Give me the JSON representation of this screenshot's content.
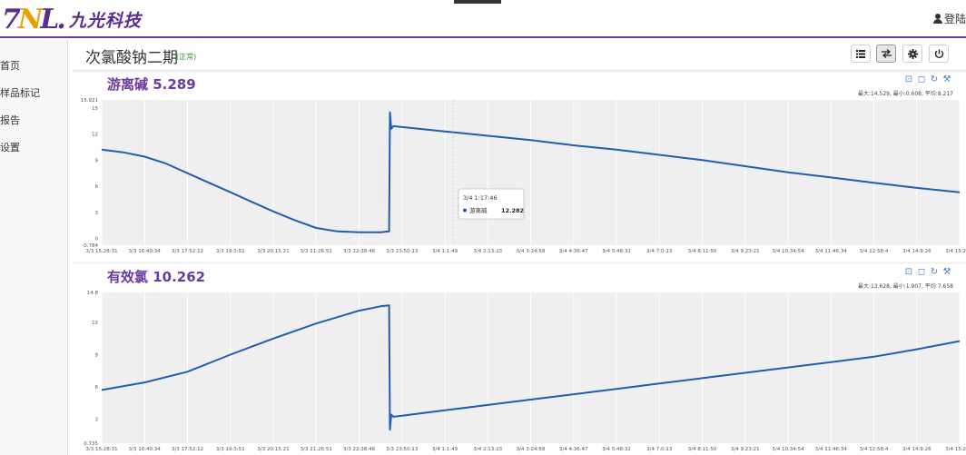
{
  "header": {
    "logo_mark": "7",
    "logo_mark_dot": "N",
    "logo_mark_end": "L.",
    "logo_text": "九光科技",
    "login_label": "登陆"
  },
  "sidebar": {
    "items": [
      {
        "label": "首页"
      },
      {
        "label": "样品标记"
      },
      {
        "label": "报告"
      },
      {
        "label": "设置"
      }
    ]
  },
  "page": {
    "title": "次氯酸钠二期",
    "status": "(正常)",
    "toolbar": {
      "list_icon": "list-icon",
      "swap_icon": "swap-icon",
      "gear_icon": "gear-icon",
      "power_icon": "power-icon"
    }
  },
  "colors": {
    "accent": "#6b3aa0",
    "series": "#1f5fb0",
    "plot_bg": "#efefef",
    "status_ok": "#2e9a2e"
  },
  "chart_data": [
    {
      "type": "line",
      "title": "游离碱 5.289",
      "stats": "最大:14.529, 最小:0.608, 平均:8.217",
      "y_tick_labels": [
        "15.921",
        "15",
        "12",
        "9",
        "6",
        "3",
        "0",
        "-0.784"
      ],
      "ylim": [
        -0.784,
        15.921
      ],
      "x_tick_labels": [
        "3/3 15:28:31",
        "3/3 16:40:34",
        "3/3 17:52:12",
        "3/3 19:3:51",
        "3/3 20:15:21",
        "3/3 21:26:51",
        "3/3 22:38:46",
        "3/3 23:50:13",
        "3/4 1:1:49",
        "3/4 2:13:23",
        "3/4 3:24:58",
        "3/4 4:36:47",
        "3/4 5:48:32",
        "3/4 7:0:13",
        "3/4 8:11:50",
        "3/4 9:23:21",
        "3/4 10:34:54",
        "3/4 11:46:34",
        "3/4 12:58:4",
        "3/4 14:9:26",
        "3/4 15:20:5"
      ],
      "x": [
        0,
        0.5,
        1,
        1.5,
        2,
        2.5,
        3,
        3.5,
        4,
        4.5,
        5,
        5.5,
        6,
        6.5,
        6.7,
        6.72,
        6.75,
        6.8,
        7,
        8,
        9,
        10,
        11,
        12,
        13,
        14,
        15,
        16,
        17,
        18,
        19,
        20
      ],
      "values": [
        10.2,
        9.9,
        9.4,
        8.6,
        7.5,
        6.4,
        5.3,
        4.2,
        3.1,
        2.1,
        1.2,
        0.8,
        0.7,
        0.7,
        0.8,
        14.5,
        12.6,
        12.9,
        12.8,
        12.3,
        11.8,
        11.3,
        10.7,
        10.2,
        9.6,
        9.0,
        8.3,
        7.6,
        7.0,
        6.4,
        5.8,
        5.3
      ],
      "tooltip": {
        "time": "3/4 1:17:46",
        "series": "游离碱",
        "value": "12.282"
      }
    },
    {
      "type": "line",
      "title": "有效氯 10.262",
      "stats": "最大:13.628, 最小:1.907, 平均:7.658",
      "y_tick_labels": [
        "14.8",
        "12",
        "9",
        "6",
        "3",
        "0.735"
      ],
      "ylim": [
        0.735,
        14.8
      ],
      "x_tick_labels": [
        "3/3 15:28:31",
        "3/3 16:40:34",
        "3/3 17:52:12",
        "3/3 19:3:51",
        "3/3 20:15:21",
        "3/3 21:26:51",
        "3/3 22:38:46",
        "3/3 23:50:13",
        "3/4 1:1:49",
        "3/4 2:13:23",
        "3/4 3:24:58",
        "3/4 4:36:47",
        "3/4 5:48:32",
        "3/4 7:0:13",
        "3/4 8:11:50",
        "3/4 9:23:21",
        "3/4 10:34:54",
        "3/4 11:46:34",
        "3/4 12:58:4",
        "3/4 14:9:26",
        "3/4 15:20:5"
      ],
      "x": [
        0,
        1,
        2,
        3,
        4,
        5,
        6,
        6.5,
        6.7,
        6.72,
        6.75,
        6.8,
        7,
        8,
        9,
        10,
        11,
        12,
        13,
        14,
        15,
        16,
        17,
        18,
        19,
        20
      ],
      "values": [
        5.7,
        6.4,
        7.4,
        9.0,
        10.5,
        11.9,
        13.1,
        13.5,
        13.6,
        2.0,
        3.4,
        3.2,
        3.3,
        3.8,
        4.3,
        4.8,
        5.3,
        5.8,
        6.3,
        6.8,
        7.3,
        7.8,
        8.3,
        8.8,
        9.5,
        10.262
      ]
    }
  ]
}
